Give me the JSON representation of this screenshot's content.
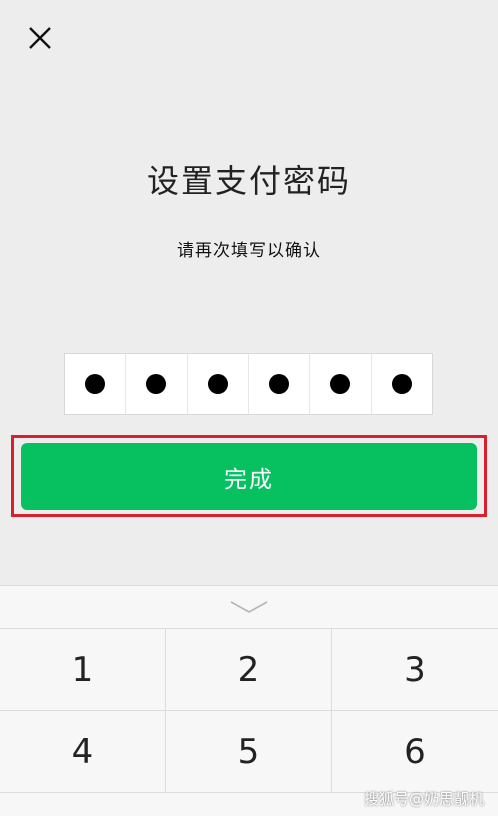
{
  "header": {
    "close_icon": "close-icon"
  },
  "main": {
    "title": "设置支付密码",
    "subtitle": "请再次填写以确认",
    "pin_length": 6,
    "pin_filled": 6,
    "done_label": "完成",
    "done_color": "#07c160",
    "highlight_color": "#d6202e"
  },
  "keyboard": {
    "handle_icon": "chevron-down-icon",
    "keys": [
      "1",
      "2",
      "3",
      "4",
      "5",
      "6"
    ]
  },
  "watermark": "搜狐号@奶思靓机"
}
